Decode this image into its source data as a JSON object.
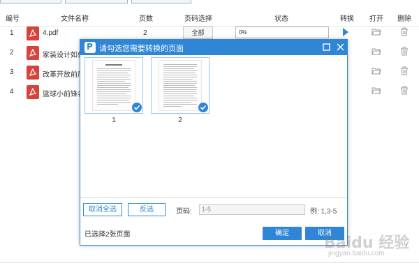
{
  "table": {
    "headers": {
      "number": "编号",
      "filename": "文件名称",
      "pages": "页数",
      "page_select": "页码选择",
      "status": "状态",
      "convert": "转换",
      "open": "打开",
      "delete": "删除"
    },
    "rows": [
      {
        "number": "1",
        "filename": "4.pdf",
        "pages": "2",
        "page_select": "全部",
        "status": "0%"
      },
      {
        "number": "2",
        "filename": "家装设计如何"
      },
      {
        "number": "3",
        "filename": "改革开放前后"
      },
      {
        "number": "4",
        "filename": "篮球小前锋名"
      }
    ]
  },
  "dialog": {
    "title": "请勾选您需要转换的页面",
    "thumbnails": [
      {
        "label": "1",
        "selected": true
      },
      {
        "label": "2",
        "selected": true
      }
    ],
    "cancel_all_label": "取消全选",
    "invert_label": "反选",
    "page_label": "页码:",
    "page_input_value": "1-5",
    "example_text": "例: 1,3-5",
    "selected_count_text": "已选择2张页面",
    "confirm_label": "确定",
    "cancel_label": "取消"
  },
  "watermark": {
    "text": "Baidu 经验",
    "sub": "jingyan.baidu.com"
  },
  "colors": {
    "accent": "#2f86d6",
    "pdf_red": "#d9423a"
  }
}
